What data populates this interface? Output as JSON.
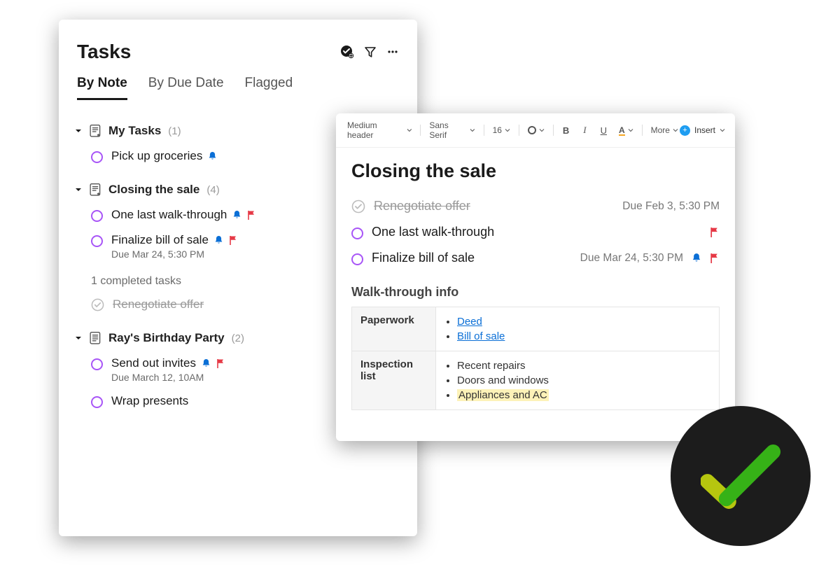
{
  "tasks": {
    "title": "Tasks",
    "tabs": [
      "By Note",
      "By Due Date",
      "Flagged"
    ],
    "groups": [
      {
        "name": "My Tasks",
        "count": "(1)",
        "items": [
          {
            "title": "Pick up groceries",
            "bell": true,
            "flag": false
          }
        ]
      },
      {
        "name": "Closing the sale",
        "count": "(4)",
        "items": [
          {
            "title": "One last walk-through",
            "bell": true,
            "flag": true
          },
          {
            "title": "Finalize bill of sale",
            "due": "Due Mar 24, 5:30 PM",
            "bell": true,
            "flag": true
          }
        ],
        "completed_label": "1 completed tasks",
        "completed": [
          {
            "title": "Renegotiate offer"
          }
        ]
      },
      {
        "name": "Ray's Birthday Party",
        "count": "(2)",
        "items": [
          {
            "title": "Send out invites",
            "due": "Due March 12, 10AM",
            "bell": true,
            "flag": true
          },
          {
            "title": "Wrap presents"
          }
        ]
      }
    ]
  },
  "note": {
    "toolbar": {
      "style": "Medium header",
      "font": "Sans Serif",
      "size": "16",
      "more": "More",
      "insert": "Insert"
    },
    "title": "Closing the sale",
    "tasks": [
      {
        "title": "Renegotiate offer",
        "done": true,
        "due": "Due Feb 3, 5:30 PM"
      },
      {
        "title": "One last walk-through",
        "done": false,
        "flag": true
      },
      {
        "title": "Finalize bill of sale",
        "done": false,
        "due": "Due Mar 24, 5:30 PM",
        "bell": true,
        "flag": true
      }
    ],
    "section_heading": "Walk-through info",
    "table": {
      "row1_label": "Paperwork",
      "row1_items": [
        "Deed",
        "Bill of sale"
      ],
      "row2_label": "Inspection list",
      "row2_items": [
        "Recent repairs",
        "Doors and windows",
        "Appliances and AC"
      ]
    }
  }
}
